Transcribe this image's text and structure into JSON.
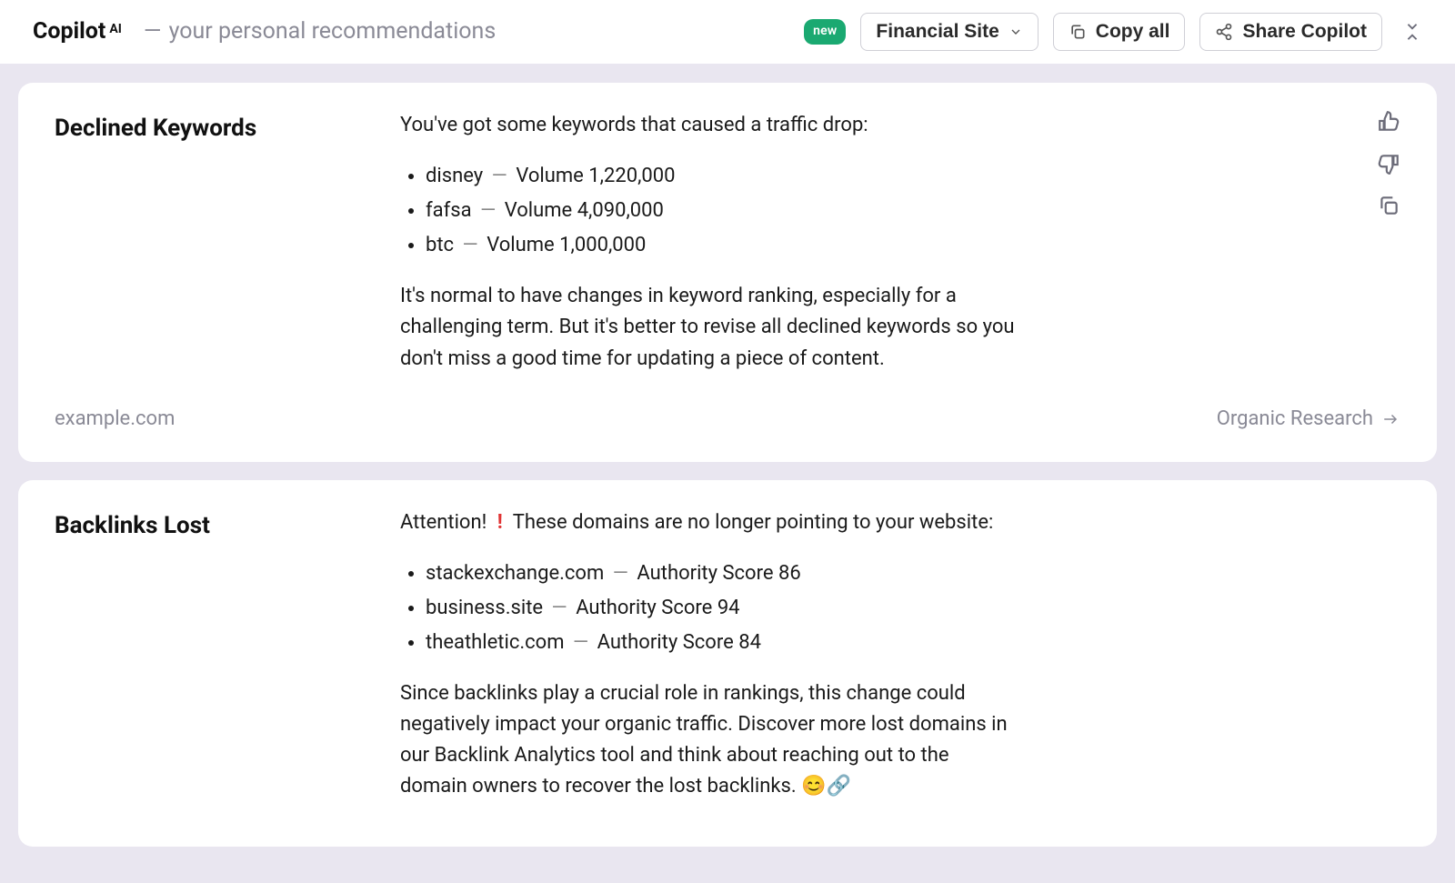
{
  "header": {
    "brand": "Copilot",
    "brand_sup": "AI",
    "subtitle": "your personal recommendations",
    "badge": "new",
    "select_label": "Financial Site",
    "copy_label": "Copy all",
    "share_label": "Share Copilot"
  },
  "cards": [
    {
      "title": "Declined Keywords",
      "intro": "You've got some keywords that caused a traffic drop:",
      "items": [
        {
          "name": "disney",
          "metric_label": "Volume",
          "metric_value": "1,220,000"
        },
        {
          "name": "fafsa",
          "metric_label": "Volume",
          "metric_value": "4,090,000"
        },
        {
          "name": "btc",
          "metric_label": "Volume",
          "metric_value": "1,000,000"
        }
      ],
      "body": "It's normal to have changes in keyword ranking, especially for a challenging term. But it's better to revise all declined keywords so you don't miss a good time for updating a piece of content.",
      "domain": "example.com",
      "link_label": "Organic Research"
    },
    {
      "title": "Backlinks Lost",
      "intro_pre": "Attention!",
      "intro_post": "These domains are no longer pointing to your website:",
      "items": [
        {
          "name": "stackexchange.com",
          "metric_label": "Authority Score",
          "metric_value": "86"
        },
        {
          "name": "business.site",
          "metric_label": "Authority Score",
          "metric_value": "94"
        },
        {
          "name": "theathletic.com",
          "metric_label": "Authority Score",
          "metric_value": "84"
        }
      ],
      "body": "Since backlinks play a crucial role in rankings, this change could negatively impact your organic traffic. Discover more lost domains in our Backlink Analytics tool and think about reaching out to the domain owners to recover the lost backlinks. 😊🔗"
    }
  ]
}
